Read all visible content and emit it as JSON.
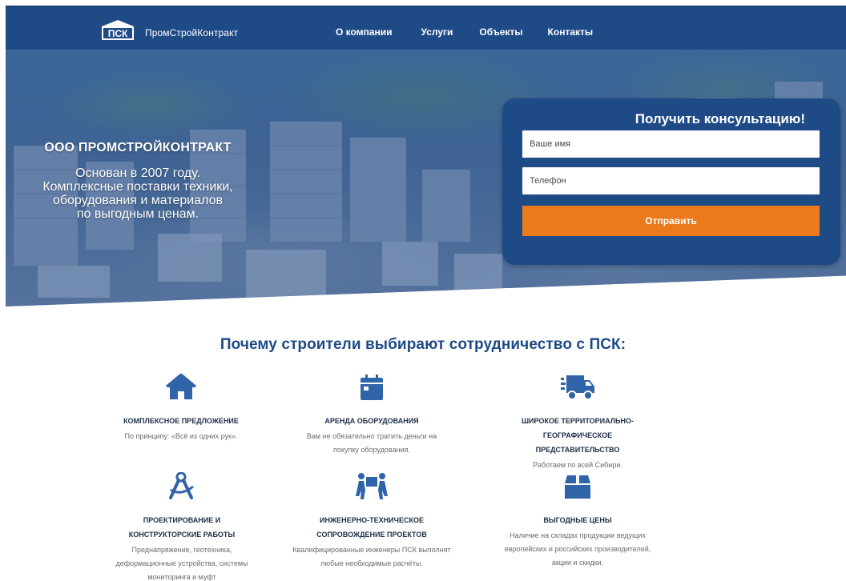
{
  "header": {
    "logo_mark": "ПСК",
    "logo_text": "ПромСтройКонтракт",
    "nav": [
      "О компании",
      "Услуги",
      "Объекты",
      "Контакты"
    ]
  },
  "hero": {
    "company": "ООО ПРОМСТРОЙКОНТРАКТ",
    "description_lines": [
      "Основан в 2007 году.",
      "Комплексные поставки техники,",
      "оборудования и материалов",
      "по выгодным ценам."
    ]
  },
  "form": {
    "title": "Получить консультацию!",
    "name_placeholder": "Ваше имя",
    "phone_placeholder": "Телефон",
    "submit_label": "Отправить"
  },
  "features": {
    "title": "Почему строители выбирают сотрудничество с ПСК:",
    "items": [
      {
        "icon": "home-icon",
        "title": "КОМПЛЕКСНОЕ ПРЕДЛОЖЕНИЕ",
        "desc": "По принципу: «Всё из одних рук»."
      },
      {
        "icon": "calendar-icon",
        "title": "АРЕНДА ОБОРУДОВАНИЯ",
        "desc": "Вам не обязательно тратить деньги на покупку оборудования."
      },
      {
        "icon": "truck-icon",
        "title": "ШИРОКОЕ ТЕРРИТОРИАЛЬНО-ГЕОГРАФИЧЕСКОЕ ПРЕДСТАВИТЕЛЬСТВО",
        "desc": "Работаем по всей Сибири."
      },
      {
        "icon": "drafting-compass-icon",
        "title": "ПРОЕКТИРОВАНИЕ И КОНСТРУКТОРСКИЕ РАБОТЫ",
        "desc": "Преднапряжение, геотехника, деформационные устройства, системы мониторинга и муфт"
      },
      {
        "icon": "people-carry-icon",
        "title": "ИНЖЕНЕРНО-ТЕХНИЧЕСКОЕ СОПРОВОЖДЕНИЕ ПРОЕКТОВ",
        "desc": "Квалифицированные инженеры ПСК выполнят любые необходимые расчёты."
      },
      {
        "icon": "box-icon",
        "title": "ВЫГОДНЫЕ ЦЕНЫ",
        "desc": "Наличие на складах продукции ведущих европейских и российских производителей, акции и скидки."
      }
    ]
  },
  "colors": {
    "brand": "#1e4a86",
    "accent": "#ea7a1b",
    "icon": "#2f64a8"
  }
}
